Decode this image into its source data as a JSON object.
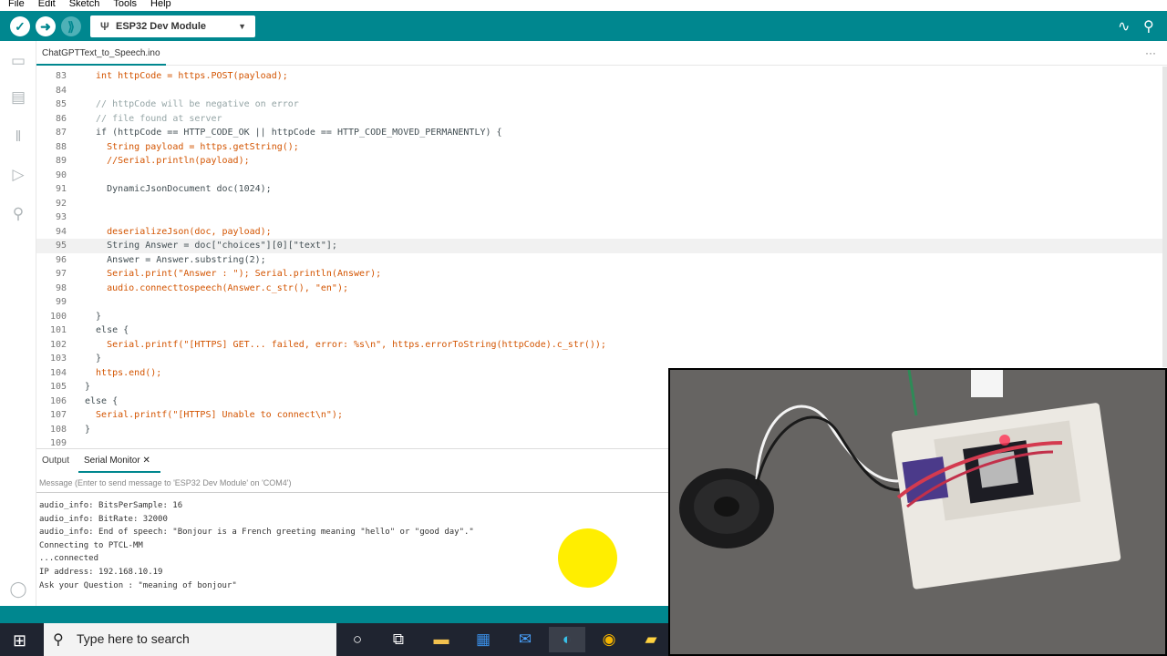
{
  "menu": [
    "File",
    "Edit",
    "Sketch",
    "Tools",
    "Help"
  ],
  "toolbar": {
    "verify_icon": "check-icon",
    "upload_icon": "arrow-right-icon",
    "debug_icon": "debug-icon",
    "board": "ESP32 Dev Module",
    "plotter_icon": "pulse-icon",
    "monitor_icon": "magnifier-icon"
  },
  "sidebar": [
    "folder-icon",
    "board-icon",
    "library-icon",
    "debug-icon",
    "search-icon",
    "account-icon"
  ],
  "file_tab": "ChatGPTText_to_Speech.ino",
  "more_icon": "···",
  "code_lines": [
    {
      "n": "83",
      "t": "  int httpCode = https.POST(payload);"
    },
    {
      "n": "84",
      "t": ""
    },
    {
      "n": "85",
      "t": "  // httpCode will be negative on error"
    },
    {
      "n": "86",
      "t": "  // file found at server"
    },
    {
      "n": "87",
      "t": "  if (httpCode == HTTP_CODE_OK || httpCode == HTTP_CODE_MOVED_PERMANENTLY) {"
    },
    {
      "n": "88",
      "t": "    String payload = https.getString();"
    },
    {
      "n": "89",
      "t": "    //Serial.println(payload);"
    },
    {
      "n": "90",
      "t": ""
    },
    {
      "n": "91",
      "t": "    DynamicJsonDocument doc(1024);"
    },
    {
      "n": "92",
      "t": ""
    },
    {
      "n": "93",
      "t": ""
    },
    {
      "n": "94",
      "t": "    deserializeJson(doc, payload);"
    },
    {
      "n": "95",
      "t": "    String Answer = doc[\"choices\"][0][\"text\"];"
    },
    {
      "n": "96",
      "t": "    Answer = Answer.substring(2);"
    },
    {
      "n": "97",
      "t": "    Serial.print(\"Answer : \"); Serial.println(Answer);"
    },
    {
      "n": "98",
      "t": "    audio.connecttospeech(Answer.c_str(), \"en\");"
    },
    {
      "n": "99",
      "t": ""
    },
    {
      "n": "100",
      "t": "  }"
    },
    {
      "n": "101",
      "t": "  else {"
    },
    {
      "n": "102",
      "t": "    Serial.printf(\"[HTTPS] GET... failed, error: %s\\n\", https.errorToString(httpCode).c_str());"
    },
    {
      "n": "103",
      "t": "  }"
    },
    {
      "n": "104",
      "t": "  https.end();"
    },
    {
      "n": "105",
      "t": "}"
    },
    {
      "n": "106",
      "t": "else {"
    },
    {
      "n": "107",
      "t": "  Serial.printf(\"[HTTPS] Unable to connect\\n\");"
    },
    {
      "n": "108",
      "t": "}"
    },
    {
      "n": "109",
      "t": ""
    }
  ],
  "highlight_line": "95",
  "bottom_tabs": {
    "output": "Output",
    "serial": "Serial Monitor",
    "close": "✕"
  },
  "message_placeholder": "Message (Enter to send message to 'ESP32 Dev Module' on 'COM4')",
  "serial_lines": [
    "audio_info: BitsPerSample: 16",
    "audio_info: BitRate: 32000",
    "audio_info: End of speech: \"Bonjour is a French greeting meaning \"hello\" or \"good day\".\"",
    "Connecting to PTCL-MM",
    "...connected",
    "IP address: 192.168.10.19",
    "Ask your Question : \"meaning of bonjour\""
  ],
  "taskbar": {
    "search_placeholder": "Type here to search",
    "apps": [
      "cortana-icon",
      "task-view-icon",
      "file-explorer-icon",
      "store-icon",
      "mail-icon",
      "edge-icon",
      "chrome-icon",
      "sticky-notes-icon"
    ]
  },
  "colors": {
    "teal": "#00878f",
    "keyword": "#00979c",
    "function": "#d35400",
    "comment": "#95a5a6",
    "string": "#005c5f"
  }
}
